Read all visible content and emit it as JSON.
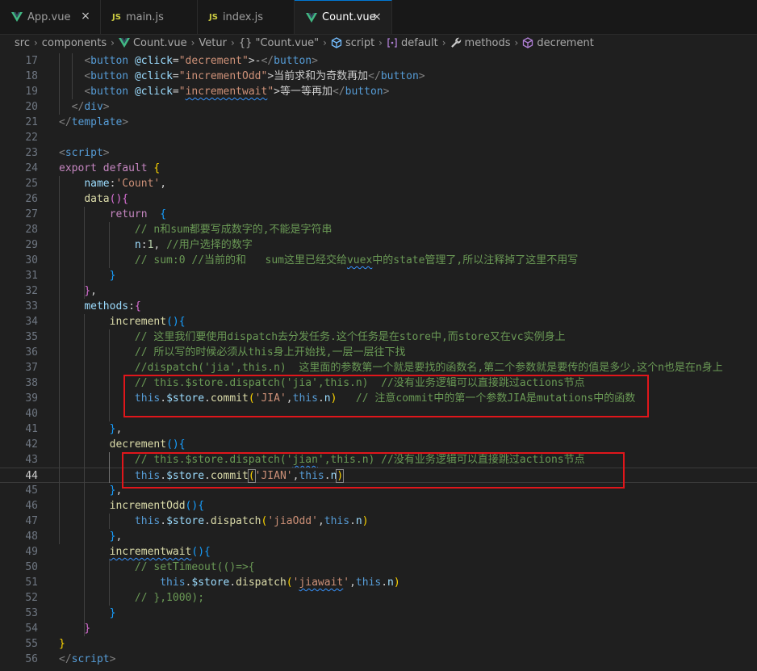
{
  "tabs": [
    {
      "label": "App.vue",
      "icon": "vue-icon",
      "active": false
    },
    {
      "label": "main.js",
      "icon": "js-icon",
      "active": false
    },
    {
      "label": "index.js",
      "icon": "js-icon",
      "active": false
    },
    {
      "label": "Count.vue",
      "icon": "vue-icon",
      "active": true
    }
  ],
  "tab_close_glyph": "×",
  "js_badge": "JS",
  "breadcrumb": {
    "src": "src",
    "components": "components",
    "file": "Count.vue",
    "vetur": "Vetur",
    "module": "{} \"Count.vue\"",
    "script": "script",
    "default": "default",
    "methods": "methods",
    "decrement": "decrement",
    "sep": "›"
  },
  "colors": {
    "accent": "#0078d4",
    "highlight_box": "#e0161b",
    "vue_green": "#41b883",
    "js_yellow": "#cbcb41"
  },
  "editor": {
    "current_line": 44,
    "lines": [
      {
        "n": "17",
        "t": [
          [
            "    ",
            ""
          ],
          [
            "<",
            "t-br"
          ],
          [
            "button",
            "t-tag"
          ],
          [
            " ",
            ""
          ],
          [
            "@click",
            "t-attr"
          ],
          [
            "=",
            ""
          ],
          [
            "\"decrement\"",
            "t-str"
          ],
          [
            ">",
            ""
          ],
          [
            "-",
            ""
          ],
          [
            "</",
            "t-br"
          ],
          [
            "button",
            "t-tag"
          ],
          [
            ">",
            "t-br"
          ]
        ]
      },
      {
        "n": "18",
        "t": [
          [
            "    ",
            ""
          ],
          [
            "<",
            "t-br"
          ],
          [
            "button",
            "t-tag"
          ],
          [
            " ",
            ""
          ],
          [
            "@click",
            "t-attr"
          ],
          [
            "=",
            ""
          ],
          [
            "\"incrementOdd\"",
            "t-str"
          ],
          [
            ">",
            ""
          ],
          [
            "当前求和为奇数再加",
            ""
          ],
          [
            "</",
            "t-br"
          ],
          [
            "button",
            "t-tag"
          ],
          [
            ">",
            "t-br"
          ]
        ]
      },
      {
        "n": "19",
        "t": [
          [
            "    ",
            ""
          ],
          [
            "<",
            "t-br"
          ],
          [
            "button",
            "t-tag"
          ],
          [
            " ",
            ""
          ],
          [
            "@click",
            "t-attr"
          ],
          [
            "=",
            ""
          ],
          [
            "\"",
            "t-str"
          ],
          [
            "incrementwait",
            "t-str sq"
          ],
          [
            "\"",
            "t-str"
          ],
          [
            ">",
            ""
          ],
          [
            "等一等再加",
            ""
          ],
          [
            "</",
            "t-br"
          ],
          [
            "button",
            "t-tag"
          ],
          [
            ">",
            "t-br"
          ]
        ]
      },
      {
        "n": "20",
        "t": [
          [
            "  ",
            ""
          ],
          [
            "</",
            "t-br"
          ],
          [
            "div",
            "t-tag"
          ],
          [
            ">",
            "t-br"
          ]
        ]
      },
      {
        "n": "21",
        "t": [
          [
            "</",
            "t-br"
          ],
          [
            "template",
            "t-tag"
          ],
          [
            ">",
            "t-br"
          ]
        ]
      },
      {
        "n": "22",
        "t": []
      },
      {
        "n": "23",
        "t": [
          [
            "<",
            "t-br"
          ],
          [
            "script",
            "t-tag"
          ],
          [
            ">",
            "t-br"
          ]
        ]
      },
      {
        "n": "24",
        "t": [
          [
            "export",
            "t-kw"
          ],
          [
            " ",
            ""
          ],
          [
            "default",
            "t-kw"
          ],
          [
            " ",
            ""
          ],
          [
            "{",
            "t-p1"
          ]
        ]
      },
      {
        "n": "25",
        "t": [
          [
            "    ",
            ""
          ],
          [
            "name",
            "t-var"
          ],
          [
            ":",
            ""
          ],
          [
            "'Count'",
            "t-str"
          ],
          [
            ",",
            ""
          ]
        ]
      },
      {
        "n": "26",
        "t": [
          [
            "    ",
            ""
          ],
          [
            "data",
            "t-fn"
          ],
          [
            "()",
            "t-p2"
          ],
          [
            "{",
            "t-p2"
          ]
        ]
      },
      {
        "n": "27",
        "t": [
          [
            "        ",
            ""
          ],
          [
            "return",
            "t-kw"
          ],
          [
            "  ",
            ""
          ],
          [
            "{",
            "t-p3"
          ]
        ]
      },
      {
        "n": "28",
        "t": [
          [
            "            ",
            ""
          ],
          [
            "// n和sum都要写成数字的,不能是字符串",
            "t-cmt"
          ]
        ]
      },
      {
        "n": "29",
        "t": [
          [
            "            ",
            ""
          ],
          [
            "n",
            "t-var"
          ],
          [
            ":",
            ""
          ],
          [
            "1",
            "t-num"
          ],
          [
            ", ",
            ""
          ],
          [
            "//用户选择的数字",
            "t-cmt"
          ]
        ]
      },
      {
        "n": "30",
        "t": [
          [
            "            ",
            ""
          ],
          [
            "// sum:0 //当前的和   sum这里已经交给",
            "t-cmt"
          ],
          [
            "vuex",
            "t-cmt sq"
          ],
          [
            "中的state管理了,所以注释掉了这里不用写",
            "t-cmt"
          ]
        ]
      },
      {
        "n": "31",
        "t": [
          [
            "        ",
            ""
          ],
          [
            "}",
            "t-p3"
          ]
        ]
      },
      {
        "n": "32",
        "t": [
          [
            "    ",
            ""
          ],
          [
            "}",
            "t-p2"
          ],
          [
            ",",
            ""
          ]
        ]
      },
      {
        "n": "33",
        "t": [
          [
            "    ",
            ""
          ],
          [
            "methods",
            "t-var"
          ],
          [
            ":",
            ""
          ],
          [
            "{",
            "t-p2"
          ]
        ]
      },
      {
        "n": "34",
        "t": [
          [
            "        ",
            ""
          ],
          [
            "increment",
            "t-fn"
          ],
          [
            "()",
            "t-p3"
          ],
          [
            "{",
            "t-p3"
          ]
        ]
      },
      {
        "n": "35",
        "t": [
          [
            "            ",
            ""
          ],
          [
            "// 这里我们要使用dispatch去分发任务.这个任务是在store中,而store又在vc实例身上",
            "t-cmt"
          ]
        ]
      },
      {
        "n": "36",
        "t": [
          [
            "            ",
            ""
          ],
          [
            "// 所以写的时候必须从this身上开始找,一层一层往下找",
            "t-cmt"
          ]
        ]
      },
      {
        "n": "37",
        "t": [
          [
            "            ",
            ""
          ],
          [
            "//dispatch('jia',this.n)  这里面的参数第一个就是要找的函数名,第二个参数就是要传的值是多少,这个n也是在n身上",
            "t-cmt"
          ]
        ]
      },
      {
        "n": "38",
        "t": [
          [
            "            ",
            ""
          ],
          [
            "// this.$store.dispatch('jia',this.n)  //没有业务逻辑可以直接跳过actions节点",
            "t-cmt"
          ]
        ]
      },
      {
        "n": "39",
        "t": [
          [
            "            ",
            ""
          ],
          [
            "this",
            "t-kw2"
          ],
          [
            ".",
            ""
          ],
          [
            "$store",
            "t-var"
          ],
          [
            ".",
            ""
          ],
          [
            "commit",
            "t-fn"
          ],
          [
            "(",
            "t-p1"
          ],
          [
            "'JIA'",
            "t-str"
          ],
          [
            ",",
            ""
          ],
          [
            "this",
            "t-kw2"
          ],
          [
            ".",
            ""
          ],
          [
            "n",
            "t-var"
          ],
          [
            ")",
            "t-p1"
          ],
          [
            "   ",
            ""
          ],
          [
            "// 注意commit中的第一个参数JIA是mutations中的函数",
            "t-cmt"
          ]
        ]
      },
      {
        "n": "40",
        "t": []
      },
      {
        "n": "41",
        "t": [
          [
            "        ",
            ""
          ],
          [
            "}",
            "t-p3"
          ],
          [
            ",",
            ""
          ]
        ]
      },
      {
        "n": "42",
        "t": [
          [
            "        ",
            ""
          ],
          [
            "decrement",
            "t-fn"
          ],
          [
            "()",
            "t-p3"
          ],
          [
            "{",
            "t-p3"
          ]
        ]
      },
      {
        "n": "43",
        "t": [
          [
            "            ",
            ""
          ],
          [
            "// this.$store.dispatch('",
            "t-cmt"
          ],
          [
            "jian",
            "t-cmt sq"
          ],
          [
            "',this.n) //没有业务逻辑可以直接跳过actions节点",
            "t-cmt"
          ]
        ]
      },
      {
        "n": "44",
        "t": [
          [
            "            ",
            ""
          ],
          [
            "this",
            "t-kw2"
          ],
          [
            ".",
            ""
          ],
          [
            "$store",
            "t-var"
          ],
          [
            ".",
            ""
          ],
          [
            "commit",
            "t-fn"
          ],
          [
            "(",
            "t-p1 pbox"
          ],
          [
            "'JIAN'",
            "t-str"
          ],
          [
            ",",
            ""
          ],
          [
            "this",
            "t-kw2"
          ],
          [
            ".",
            ""
          ],
          [
            "n",
            "t-var"
          ],
          [
            ")",
            "t-p1 pbox"
          ]
        ]
      },
      {
        "n": "45",
        "t": [
          [
            "        ",
            ""
          ],
          [
            "}",
            "t-p3"
          ],
          [
            ",",
            ""
          ]
        ]
      },
      {
        "n": "46",
        "t": [
          [
            "        ",
            ""
          ],
          [
            "incrementOdd",
            "t-fn"
          ],
          [
            "()",
            "t-p3"
          ],
          [
            "{",
            "t-p3"
          ]
        ]
      },
      {
        "n": "47",
        "t": [
          [
            "            ",
            ""
          ],
          [
            "this",
            "t-kw2"
          ],
          [
            ".",
            ""
          ],
          [
            "$store",
            "t-var"
          ],
          [
            ".",
            ""
          ],
          [
            "dispatch",
            "t-fn"
          ],
          [
            "(",
            "t-p1"
          ],
          [
            "'jiaOdd'",
            "t-str"
          ],
          [
            ",",
            ""
          ],
          [
            "this",
            "t-kw2"
          ],
          [
            ".",
            ""
          ],
          [
            "n",
            "t-var"
          ],
          [
            ")",
            "t-p1"
          ]
        ]
      },
      {
        "n": "48",
        "t": [
          [
            "        ",
            ""
          ],
          [
            "}",
            "t-p3"
          ],
          [
            ",",
            ""
          ]
        ]
      },
      {
        "n": "49",
        "t": [
          [
            "        ",
            ""
          ],
          [
            "incrementwait",
            "t-fn sq"
          ],
          [
            "()",
            "t-p3"
          ],
          [
            "{",
            "t-p3"
          ]
        ]
      },
      {
        "n": "50",
        "t": [
          [
            "            ",
            ""
          ],
          [
            "// setTimeout(()=>{",
            "t-cmt"
          ]
        ]
      },
      {
        "n": "51",
        "t": [
          [
            "                ",
            ""
          ],
          [
            "this",
            "t-kw2"
          ],
          [
            ".",
            ""
          ],
          [
            "$store",
            "t-var"
          ],
          [
            ".",
            ""
          ],
          [
            "dispatch",
            "t-fn"
          ],
          [
            "(",
            "t-p1"
          ],
          [
            "'",
            "t-str"
          ],
          [
            "jiawait",
            "t-str sq"
          ],
          [
            "'",
            "t-str"
          ],
          [
            ",",
            ""
          ],
          [
            "this",
            "t-kw2"
          ],
          [
            ".",
            ""
          ],
          [
            "n",
            "t-var"
          ],
          [
            ")",
            "t-p1"
          ]
        ]
      },
      {
        "n": "52",
        "t": [
          [
            "            ",
            ""
          ],
          [
            "// },1000);",
            "t-cmt"
          ]
        ]
      },
      {
        "n": "53",
        "t": [
          [
            "        ",
            ""
          ],
          [
            "}",
            "t-p3"
          ]
        ]
      },
      {
        "n": "54",
        "t": [
          [
            "    ",
            ""
          ],
          [
            "}",
            "t-p2"
          ]
        ]
      },
      {
        "n": "55",
        "t": [
          [
            "}",
            "t-p1"
          ]
        ]
      },
      {
        "n": "56",
        "t": [
          [
            "</",
            "t-br"
          ],
          [
            "script",
            "t-tag"
          ],
          [
            ">",
            "t-br"
          ]
        ]
      }
    ]
  }
}
